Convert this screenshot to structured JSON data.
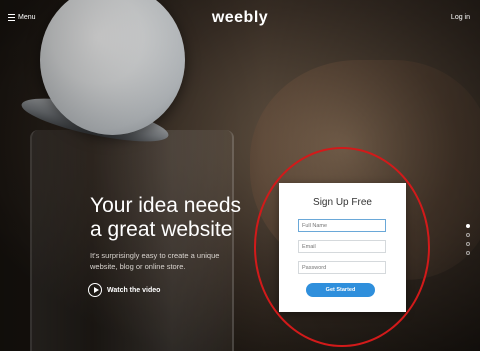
{
  "nav": {
    "menu_label": "Menu",
    "logo_text": "weebly",
    "login_label": "Log in"
  },
  "hero": {
    "headline_line1": "Your idea needs",
    "headline_line2": "a great website",
    "subtext_line1": "It's surprisingly easy to create a unique",
    "subtext_line2": "website, blog or online store.",
    "watch_label": "Watch the video"
  },
  "signup": {
    "title": "Sign Up Free",
    "full_name_placeholder": "Full Name",
    "email_placeholder": "Email",
    "password_placeholder": "Password",
    "button_label": "Get Started"
  },
  "slider": {
    "slide_count": 4,
    "active_index": 0
  },
  "colors": {
    "accent_button": "#2f8fdc",
    "highlight_ring": "#d21a1a"
  },
  "icons": [
    "menu-icon",
    "play-icon"
  ]
}
